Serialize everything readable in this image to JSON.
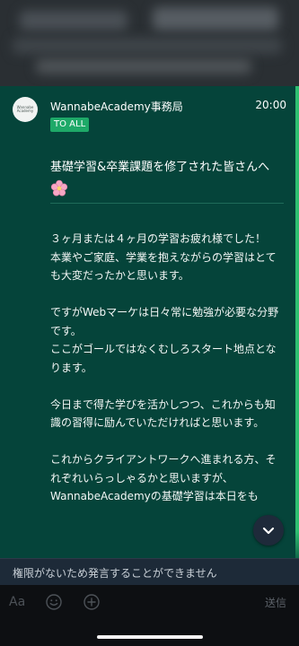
{
  "message": {
    "avatar_text": "Wannabe Academy",
    "sender": "WannabeAcademy事務局",
    "time": "20:00",
    "badge": "TO ALL",
    "title": "基礎学習&卒業課題を修了された皆さんへ",
    "title_emoji_icon": "cherry-blossom-icon",
    "paragraphs": [
      "３ヶ月または４ヶ月の学習お疲れ様でした！\n本業やご家庭、学業を抱えながらの学習はとても大変だったかと思います。",
      "ですがWebマーケは日々常に勉強が必要な分野です。\nここがゴールではなくむしろスタート地点となります。",
      "今日まで得た学びを活かしつつ、これからも知識の習得に励んでいただければと思います。",
      "これからクライアントワークへ進まれる方、それぞれいらっしゃるかと思いますが、WannabeAcademyの基礎学習は本日をも"
    ],
    "accent_color": "#2fbf71",
    "badge_color": "#1ea968"
  },
  "notice": {
    "text": "権限がないため発言することができません"
  },
  "input_bar": {
    "aa_label": "Aa",
    "emoji_icon": "smiley-icon",
    "plus_icon": "plus-circle-icon",
    "send_label": "送信"
  },
  "scroll_button_icon": "chevron-down-icon"
}
